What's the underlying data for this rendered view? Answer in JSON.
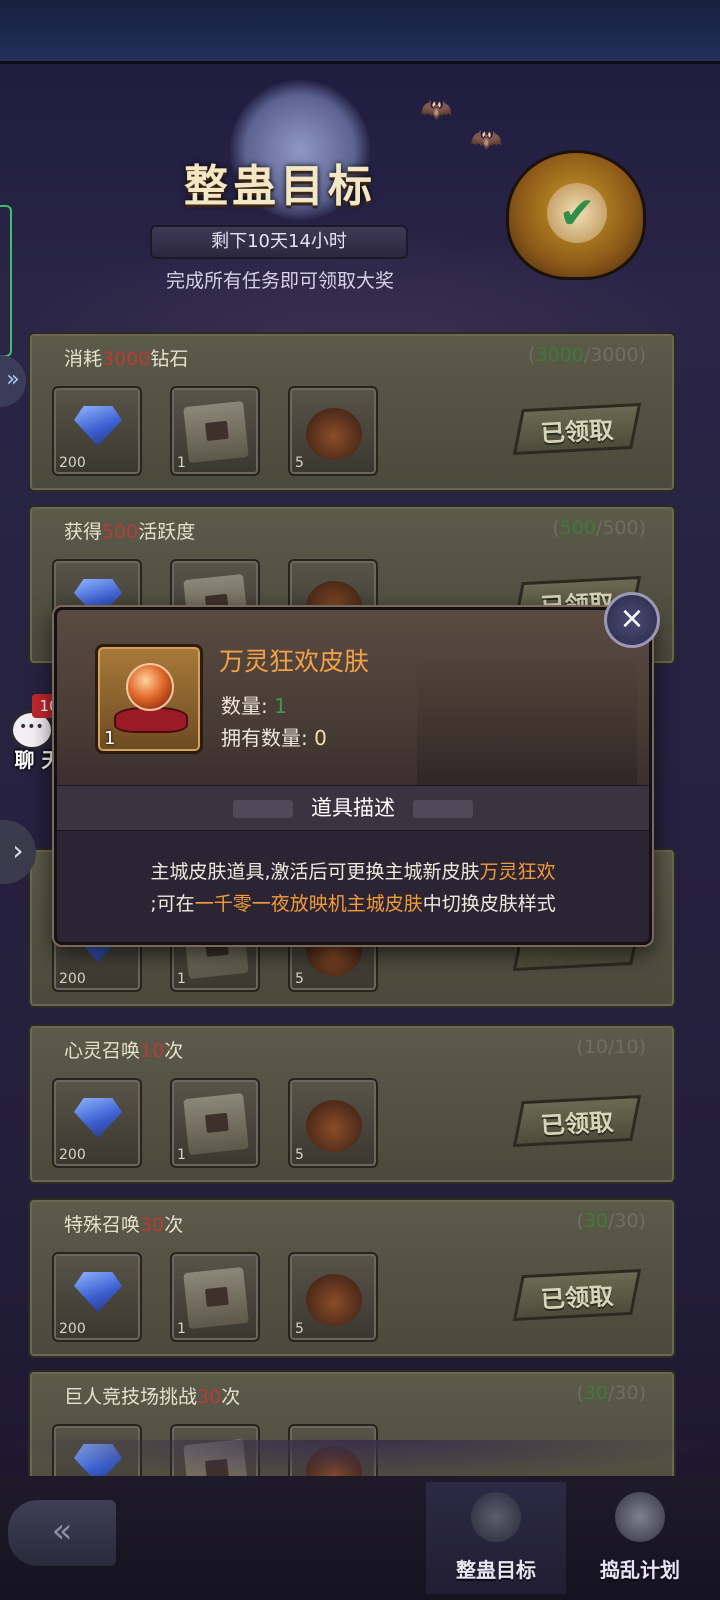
{
  "header": {
    "banner_title": "整蛊目标",
    "countdown": "剩下10天14小时",
    "subtitle": "完成所有任务即可领取大奖"
  },
  "tasks": [
    {
      "title_prefix": "消耗",
      "title_amount": "3000",
      "title_suffix": "钻石",
      "progress_open": "(",
      "progress_current": "3000",
      "progress_rest": "/3000)",
      "rewards": [
        "200",
        "1",
        "5"
      ],
      "status": "已领取"
    },
    {
      "title_prefix": "获得",
      "title_amount": "500",
      "title_suffix": "活跃度",
      "progress_open": "(",
      "progress_current": "500",
      "progress_rest": "/500)",
      "rewards": [
        "",
        "",
        ""
      ],
      "status": "已领取"
    },
    {
      "title_prefix": "",
      "title_amount": "",
      "title_suffix": "",
      "progress_open": "",
      "progress_current": "",
      "progress_rest": "",
      "rewards": [
        "200",
        "1",
        "5"
      ],
      "status": ""
    },
    {
      "title_prefix": "心灵召唤",
      "title_amount": "10",
      "title_suffix": "次",
      "progress_open": "(",
      "progress_current": "10",
      "progress_rest": "/10)",
      "rewards": [
        "200",
        "1",
        "5"
      ],
      "status": "已领取"
    },
    {
      "title_prefix": "特殊召唤",
      "title_amount": "30",
      "title_suffix": "次",
      "progress_open": "(",
      "progress_current": "30",
      "progress_rest": "/30)",
      "rewards": [
        "200",
        "1",
        "5"
      ],
      "status": "已领取"
    },
    {
      "title_prefix": "巨人竞技场挑战",
      "title_amount": "30",
      "title_suffix": "次",
      "progress_open": "(",
      "progress_current": "30",
      "progress_rest": "/30)",
      "rewards": [
        "",
        "",
        ""
      ],
      "status": ""
    }
  ],
  "chat": {
    "label": "聊 天",
    "badge": "10"
  },
  "popup": {
    "item_name": "万灵狂欢皮肤",
    "item_qty_badge": "1",
    "quantity_label": "数量:",
    "quantity_value": "1",
    "owned_label": "拥有数量:",
    "owned_value": "0",
    "section_title": "道具描述",
    "desc_line1_a": "主城皮肤道具,激活后可更换主城新皮肤",
    "desc_line1_b": "万灵狂欢",
    "desc_line2_a": ";可在",
    "desc_line2_b": "一千零一夜放映机主城皮肤",
    "desc_line2_c": "中切换皮肤样式",
    "close_icon": "×"
  },
  "bottom_nav": {
    "tabs": [
      {
        "label": "整蛊目标",
        "active": true
      },
      {
        "label": "捣乱计划",
        "active": false
      }
    ]
  },
  "colors": {
    "highlight_orange": "#f39b39",
    "title_red": "#b63c37",
    "progress_green": "#3f7a3c"
  }
}
